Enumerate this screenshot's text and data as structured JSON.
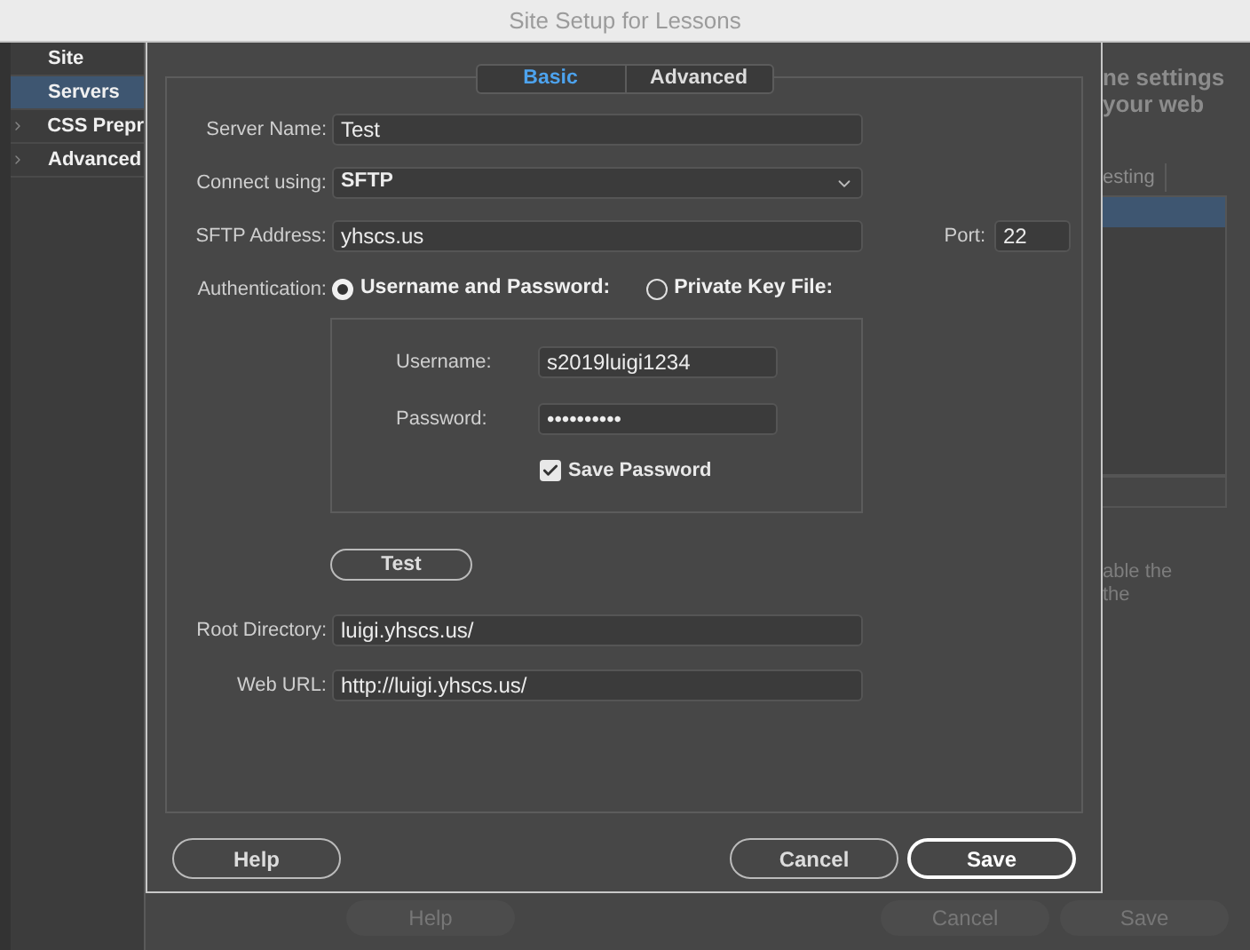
{
  "background_window": {
    "title": "Site Setup for Lessons",
    "sidebar_items": [
      {
        "label": "Site",
        "selected": false,
        "expandable": false
      },
      {
        "label": "Servers",
        "selected": true,
        "expandable": false
      },
      {
        "label": "CSS Prepr",
        "selected": false,
        "expandable": true
      },
      {
        "label": "Advanced",
        "selected": false,
        "expandable": true
      }
    ],
    "intro_lines": [
      "ne settings",
      "your web"
    ],
    "table_tab": "esting",
    "note_lines": [
      "able the",
      "the"
    ],
    "buttons": [
      "Help",
      "Cancel",
      "Save"
    ]
  },
  "dialog": {
    "tabs": [
      {
        "label": "Basic",
        "selected": true
      },
      {
        "label": "Advanced",
        "selected": false
      }
    ],
    "server_name": {
      "label": "Server Name:",
      "value": "Test"
    },
    "connect_using": {
      "label": "Connect using:",
      "value": "SFTP"
    },
    "address": {
      "label": "SFTP Address:",
      "value": "yhscs.us"
    },
    "port": {
      "label": "Port:",
      "value": "22"
    },
    "authentication": {
      "label": "Authentication:",
      "options": [
        {
          "label": "Username and Password:",
          "selected": true
        },
        {
          "label": "Private Key File:",
          "selected": false
        }
      ]
    },
    "username": {
      "label": "Username:",
      "value": "s2019luigi1234"
    },
    "password": {
      "label": "Password:",
      "value": "••••••••••"
    },
    "save_password": {
      "label": "Save Password",
      "checked": true
    },
    "test_button": "Test",
    "root_directory": {
      "label": "Root Directory:",
      "value": "luigi.yhscs.us/"
    },
    "web_url": {
      "label": "Web URL:",
      "value": "http://luigi.yhscs.us/"
    },
    "buttons": [
      {
        "label": "Help",
        "kind": "secondary"
      },
      {
        "label": "Cancel",
        "kind": "secondary"
      },
      {
        "label": "Save",
        "kind": "default"
      }
    ]
  }
}
